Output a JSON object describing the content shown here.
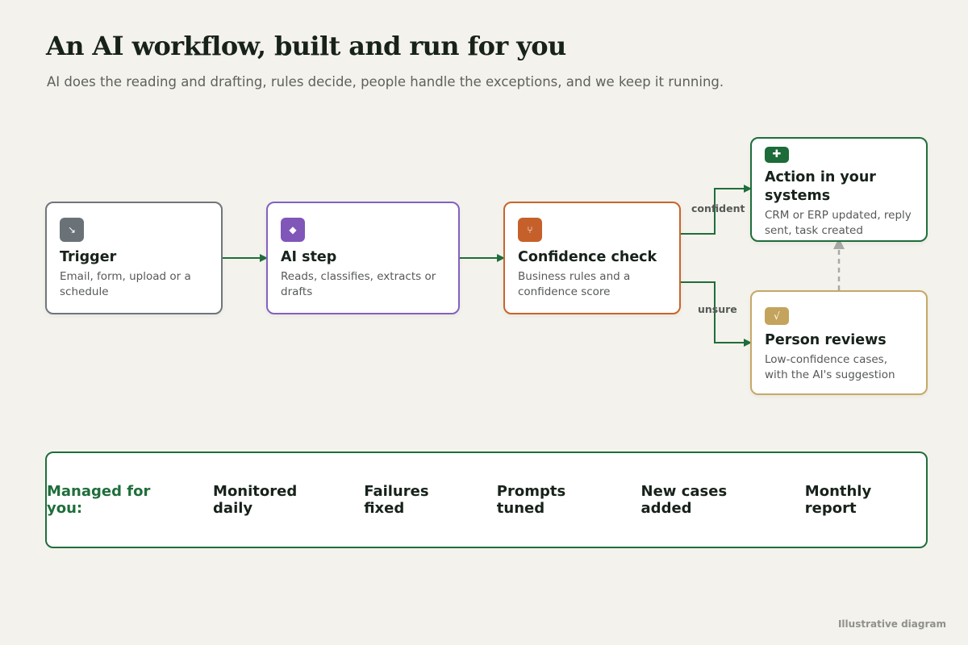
{
  "header": {
    "title": "An AI workflow, built and run for you",
    "subtitle": "AI does the reading and drafting, rules decide, people handle the exceptions, and we keep it running."
  },
  "nodes": {
    "trigger": {
      "icon": "↘",
      "icon_name": "arrow-in-icon",
      "title": "Trigger",
      "desc": "Email, form, upload or a schedule",
      "color": "#6a7278"
    },
    "ai_step": {
      "icon": "◆",
      "icon_name": "diamond-icon",
      "title": "AI step",
      "desc": "Reads, classifies, extracts or drafts",
      "color": "#8056b9"
    },
    "confidence": {
      "icon": "⑂",
      "icon_name": "fork-icon",
      "title": "Confidence check",
      "desc": "Business rules and a confidence score",
      "color": "#c6602a"
    },
    "action": {
      "icon": "✚",
      "icon_name": "plus-icon",
      "title": "Action in your systems",
      "desc": "CRM or ERP updated, reply sent, task created",
      "color": "#1c6b38"
    },
    "review": {
      "icon": "√",
      "icon_name": "check-icon",
      "title": "Person reviews",
      "desc": "Low-confidence cases, with the AI's suggestion",
      "color": "#c4a35c"
    }
  },
  "edges": {
    "confident_label": "confident",
    "unsure_label": "unsure"
  },
  "managed": {
    "label": "Managed for you:",
    "items": [
      "Monitored daily",
      "Failures fixed",
      "Prompts tuned",
      "New cases added",
      "Monthly report"
    ]
  },
  "footer": {
    "note": "Illustrative diagram"
  },
  "colors": {
    "background": "#f4f2ec",
    "arrow": "#1f6e3b",
    "dashed_arrow": "#a7aaa6"
  }
}
